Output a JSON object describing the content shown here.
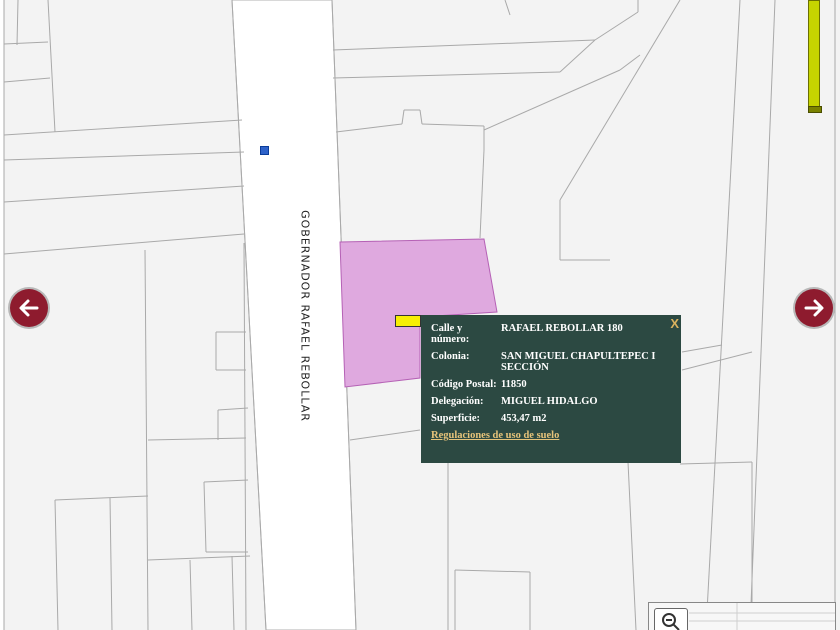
{
  "map": {
    "street_label": "GOBERNADOR RAFAEL REBOLLAR",
    "colors": {
      "background": "#f3f3f3",
      "road": "#ffffff",
      "lot_lines": "#a8a8a8",
      "selected_parcel": "#dfa9df",
      "nav_arrow": "#8e1b2e",
      "popup_bg": "#2c4942",
      "popup_link": "#e6c37a",
      "zoom_slider": "#c6d400"
    }
  },
  "navigation": {
    "left_icon": "arrow-left-icon",
    "right_icon": "arrow-right-icon"
  },
  "popup": {
    "close_label": "X",
    "rows": [
      {
        "key": "Calle y número:",
        "value": "RAFAEL REBOLLAR 180"
      },
      {
        "key": "Colonia:",
        "value": "SAN MIGUEL CHAPULTEPEC I SECCIÓN"
      },
      {
        "key": "Código Postal:",
        "value": "11850"
      },
      {
        "key": "Delegación:",
        "value": "MIGUEL HIDALGO"
      },
      {
        "key": "Superficie:",
        "value": "453,47 m2"
      }
    ],
    "link_label": "Regulaciones de uso de suelo"
  },
  "controls": {
    "zoom_out_icon": "zoom-out-icon",
    "zoom_slider_icon": "zoom-slider"
  }
}
